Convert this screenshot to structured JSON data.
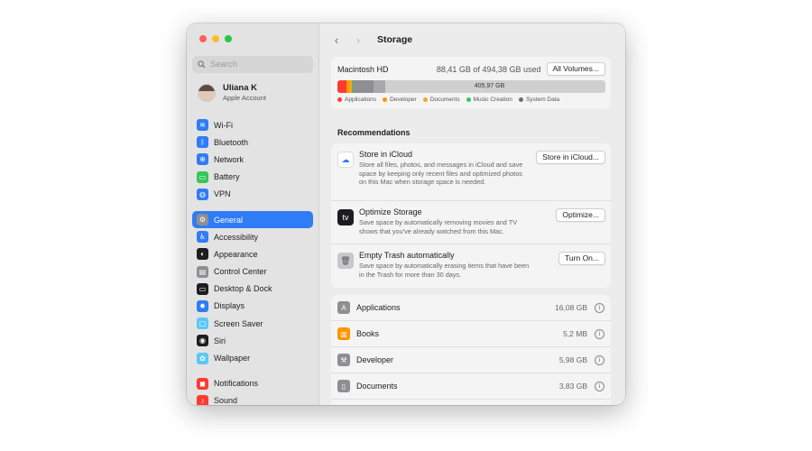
{
  "sidebar": {
    "search_placeholder": "Search",
    "account": {
      "name": "Uliana K",
      "subtitle": "Apple Account"
    },
    "groups": [
      [
        {
          "label": "Wi-Fi",
          "icon": "wifi-icon",
          "color": "#2f7cf6",
          "glyph": "≋"
        },
        {
          "label": "Bluetooth",
          "icon": "bluetooth-icon",
          "color": "#2f7cf6",
          "glyph": "ᛒ"
        },
        {
          "label": "Network",
          "icon": "network-icon",
          "color": "#2f7cf6",
          "glyph": "⊕"
        },
        {
          "label": "Battery",
          "icon": "battery-icon",
          "color": "#34c759",
          "glyph": "▭"
        },
        {
          "label": "VPN",
          "icon": "vpn-icon",
          "color": "#2f7cf6",
          "glyph": "◍"
        }
      ],
      [
        {
          "label": "General",
          "icon": "gear-icon",
          "color": "#8e8e93",
          "glyph": "⚙",
          "selected": true
        },
        {
          "label": "Accessibility",
          "icon": "accessibility-icon",
          "color": "#2f7cf6",
          "glyph": "♿"
        },
        {
          "label": "Appearance",
          "icon": "appearance-icon",
          "color": "#1d1d1f",
          "glyph": "◐"
        },
        {
          "label": "Control Center",
          "icon": "control-center-icon",
          "color": "#8e8e93",
          "glyph": "▤"
        },
        {
          "label": "Desktop & Dock",
          "icon": "desktop-dock-icon",
          "color": "#1d1d1f",
          "glyph": "▭"
        },
        {
          "label": "Displays",
          "icon": "displays-icon",
          "color": "#2f7cf6",
          "glyph": "✹"
        },
        {
          "label": "Screen Saver",
          "icon": "screen-saver-icon",
          "color": "#5ac8fa",
          "glyph": "▢"
        },
        {
          "label": "Siri",
          "icon": "siri-icon",
          "color": "#1d1d1f",
          "glyph": "◉"
        },
        {
          "label": "Wallpaper",
          "icon": "wallpaper-icon",
          "color": "#5ac8fa",
          "glyph": "✿"
        }
      ],
      [
        {
          "label": "Notifications",
          "icon": "notifications-icon",
          "color": "#ff3b30",
          "glyph": "◼"
        },
        {
          "label": "Sound",
          "icon": "sound-icon",
          "color": "#ff3b30",
          "glyph": "♪"
        }
      ]
    ]
  },
  "toolbar": {
    "title": "Storage",
    "back_icon": "chevron-left-icon",
    "forward_icon": "chevron-right-icon"
  },
  "storage": {
    "disk_name": "Macintosh HD",
    "used_text": "88,41 GB of 494,38 GB used",
    "all_volumes_label": "All Volumes...",
    "free_label": "405,97 GB",
    "segments": [
      {
        "name": "Applications",
        "color": "#ff3b30",
        "fraction": 0.0325
      },
      {
        "name": "Developer",
        "color": "#ff9500",
        "fraction": 0.0121
      },
      {
        "name": "Documents",
        "color": "#f5a623",
        "fraction": 0.0077
      },
      {
        "name": "Music Creation",
        "color": "#34c759",
        "fraction": 0.004
      },
      {
        "name": "System Data",
        "color": "#8e8e93",
        "fraction": 0.078
      },
      {
        "name": "Other",
        "color": "#a8a8a8",
        "fraction": 0.045
      }
    ],
    "legend": [
      {
        "label": "Applications",
        "color": "#ff3b30"
      },
      {
        "label": "Developer",
        "color": "#ff9500"
      },
      {
        "label": "Documents",
        "color": "#f5a623"
      },
      {
        "label": "Music Creation",
        "color": "#34c759"
      },
      {
        "label": "System Data",
        "color": "#6e6e73"
      }
    ]
  },
  "recommendations": {
    "title": "Recommendations",
    "items": [
      {
        "title": "Store in iCloud",
        "desc": "Store all files, photos, and messages in iCloud and save space by keeping only recent files and optimized photos on this Mac when storage space is needed.",
        "button": "Store in iCloud...",
        "icon": "icloud-icon",
        "color": "#ffffff",
        "glyph": "☁"
      },
      {
        "title": "Optimize Storage",
        "desc": "Save space by automatically removing movies and TV shows that you've already watched from this Mac.",
        "button": "Optimize...",
        "icon": "apple-tv-icon",
        "color": "#1d1d1f",
        "glyph": "tv"
      },
      {
        "title": "Empty Trash automatically",
        "desc": "Save space by automatically erasing items that have been in the Trash for more than 30 days.",
        "button": "Turn On...",
        "icon": "trash-icon",
        "color": "#c7c7cc",
        "glyph": "🗑"
      }
    ]
  },
  "categories": [
    {
      "name": "Applications",
      "size": "16,08 GB",
      "icon": "applications-icon",
      "color": "#8e8e93",
      "glyph": "A"
    },
    {
      "name": "Books",
      "size": "5,2 MB",
      "icon": "books-icon",
      "color": "#ff9500",
      "glyph": "▥"
    },
    {
      "name": "Developer",
      "size": "5,98 GB",
      "icon": "developer-icon",
      "color": "#8e8e93",
      "glyph": "⚒"
    },
    {
      "name": "Documents",
      "size": "3,83 GB",
      "icon": "documents-icon",
      "color": "#8e8e93",
      "glyph": "▯"
    }
  ]
}
